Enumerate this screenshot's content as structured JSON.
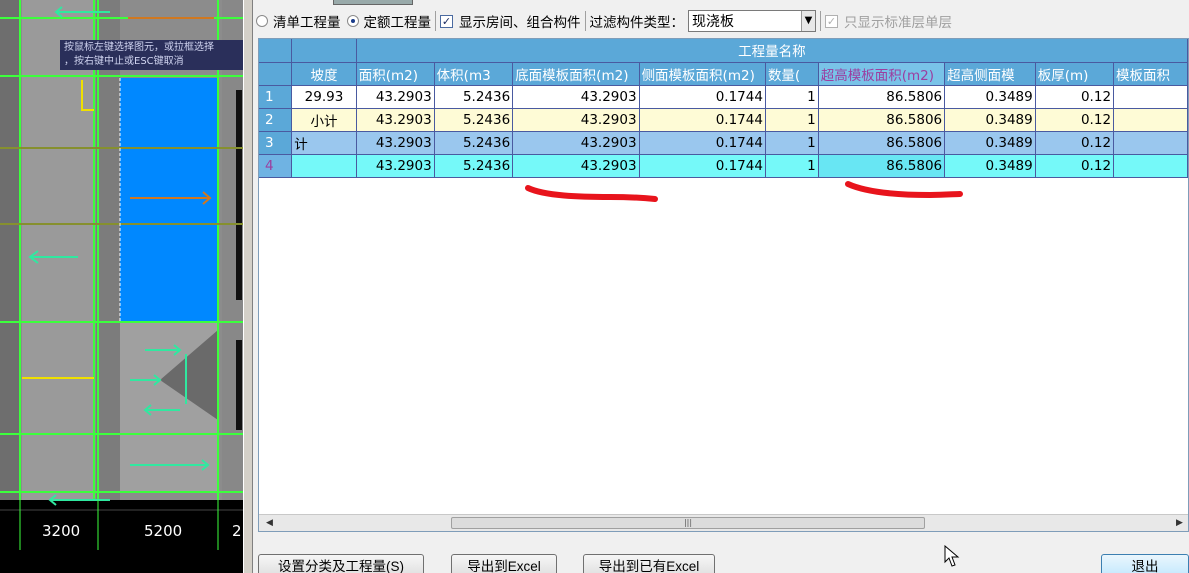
{
  "cad": {
    "hint_line1": "按鼠标左键选择图元，或拉框选择",
    "hint_line2": "，按右键中止或ESC键取消",
    "dimensions": [
      "3200",
      "5200",
      "2"
    ]
  },
  "toolbar": {
    "radio_list": "清单工程量",
    "radio_quota": "定额工程量",
    "show_rooms_label": "显示房间、组合构件",
    "filter_label": "过滤构件类型：",
    "filter_value": "现浇板",
    "only_standard_label": "只显示标准层单层"
  },
  "grid": {
    "group_header": "工程量名称",
    "columns": [
      "坡度",
      "面积(m2)",
      "体积(m3",
      "底面模板面积(m2)",
      "侧面模板面积(m2)",
      "数量(",
      "超高模板面积(m2)",
      "超高侧面模",
      "板厚(m)",
      "模板面积"
    ],
    "rows": [
      {
        "n": "1",
        "c0": "29.93",
        "c1": "43.2903",
        "c2": "5.2436",
        "c3": "43.2903",
        "c4": "0.1744",
        "c5": "1",
        "c6": "86.5806",
        "c7": "0.3489",
        "c8": "0.12",
        "c9": ""
      },
      {
        "n": "2",
        "c0": "小计",
        "c1": "43.2903",
        "c2": "5.2436",
        "c3": "43.2903",
        "c4": "0.1744",
        "c5": "1",
        "c6": "86.5806",
        "c7": "0.3489",
        "c8": "0.12",
        "c9": ""
      },
      {
        "n": "3",
        "c0": "计",
        "c1": "43.2903",
        "c2": "5.2436",
        "c3": "43.2903",
        "c4": "0.1744",
        "c5": "1",
        "c6": "86.5806",
        "c7": "0.3489",
        "c8": "0.12",
        "c9": ""
      },
      {
        "n": "4",
        "c0": "",
        "c1": "43.2903",
        "c2": "5.2436",
        "c3": "43.2903",
        "c4": "0.1744",
        "c5": "1",
        "c6": "86.5806",
        "c7": "0.3489",
        "c8": "0.12",
        "c9": ""
      }
    ],
    "scroll_thumb_glyph": "|||"
  },
  "buttons": {
    "set_category": "设置分类及工程量(S)",
    "export_excel": "导出到Excel",
    "export_existing": "导出到已有Excel",
    "exit": "退出"
  },
  "colors": {
    "grid_header": "#5ba8d8",
    "highlight_text": "#9b3fa0",
    "row_subtotal": "#fefbd6",
    "row_total": "#9ac7ee",
    "row_selected": "#75f9f9",
    "annotation_red": "#e8141c"
  }
}
